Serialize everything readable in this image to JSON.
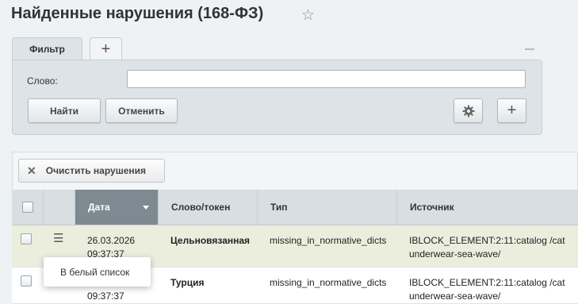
{
  "page": {
    "title": "Найденные нарушения (168-ФЗ)"
  },
  "filter": {
    "tab_label": "Фильтр",
    "add_tab_label": "+",
    "word_label": "Слово:",
    "word_value": "",
    "find_label": "Найти",
    "cancel_label": "Отменить",
    "plus_label": "+"
  },
  "toolbar": {
    "clear_label": "Очистить нарушения"
  },
  "table": {
    "columns": [
      "Дата",
      "Слово/токен",
      "Тип",
      "Источник"
    ],
    "sorted_column": "Дата",
    "rows": [
      {
        "date": "26.03.2026",
        "time": "09:37:37",
        "word": "Цельновязанная",
        "type": "missing_in_normative_dicts",
        "source_line1": "IBLOCK_ELEMENT:2:11:catalog /cat",
        "source_line2": "underwear-sea-wave/"
      },
      {
        "date": "",
        "time": "09:37:37",
        "word": "Турция",
        "type": "missing_in_normative_dicts",
        "source_line1": "IBLOCK_ELEMENT:2:11:catalog /cat",
        "source_line2": "underwear-sea-wave/"
      }
    ]
  },
  "context_menu": {
    "items": [
      "В белый список"
    ]
  },
  "colors": {
    "sorted_header_bg": "#7d8a91",
    "highlight_row_bg": "#eceedd",
    "filter_bg": "#dde3e6"
  }
}
